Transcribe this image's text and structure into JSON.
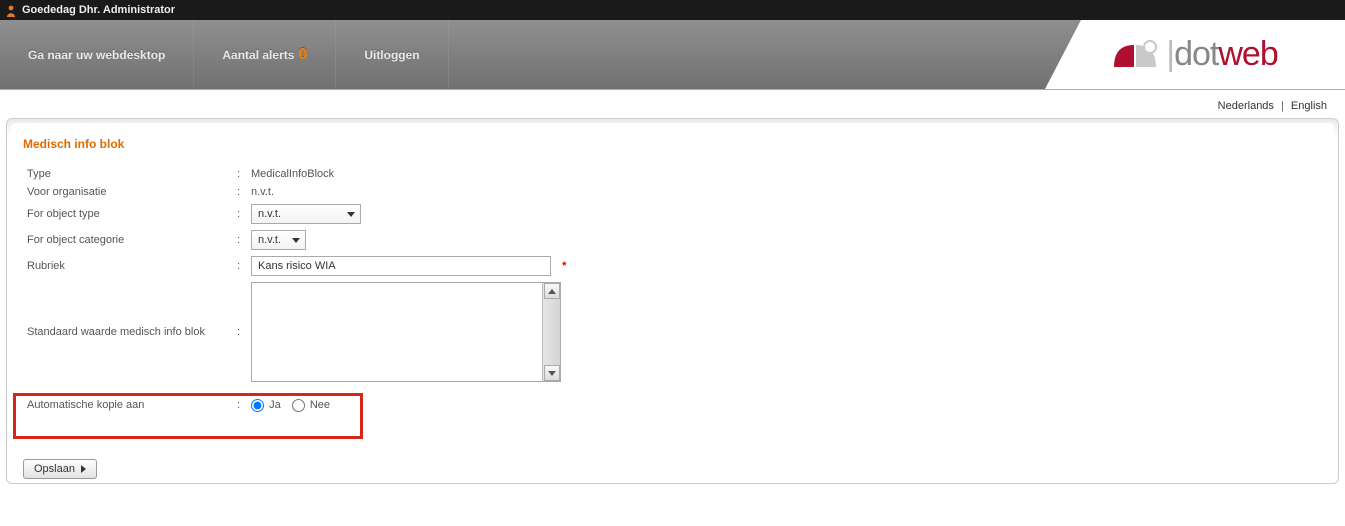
{
  "topbar": {
    "greeting": "Goededag  Dhr. Administrator"
  },
  "nav": {
    "webdesktop": "Ga naar uw webdesktop",
    "alerts_label": "Aantal alerts",
    "alerts_count": "0",
    "logout": "Uitloggen"
  },
  "logo": {
    "part1": "dot",
    "part2": "web"
  },
  "lang": {
    "nl": "Nederlands",
    "en": "English"
  },
  "panel": {
    "title": "Medisch info blok",
    "labels": {
      "type": "Type",
      "voor_org": "Voor organisatie",
      "obj_type": "For object type",
      "obj_cat": "For object categorie",
      "rubriek": "Rubriek",
      "std_waarde": "Standaard waarde medisch info blok",
      "auto_kopie": "Automatische kopie aan"
    },
    "colon": ":",
    "values": {
      "type": "MedicalInfoBlock",
      "voor_org": "n.v.t.",
      "obj_type": "n.v.t.",
      "obj_cat": "n.v.t.",
      "rubriek": "Kans risico WIA",
      "std_waarde": ""
    },
    "required_mark": "*",
    "radio": {
      "ja": "Ja",
      "nee": "Nee",
      "selected": "ja"
    },
    "save": "Opslaan"
  }
}
